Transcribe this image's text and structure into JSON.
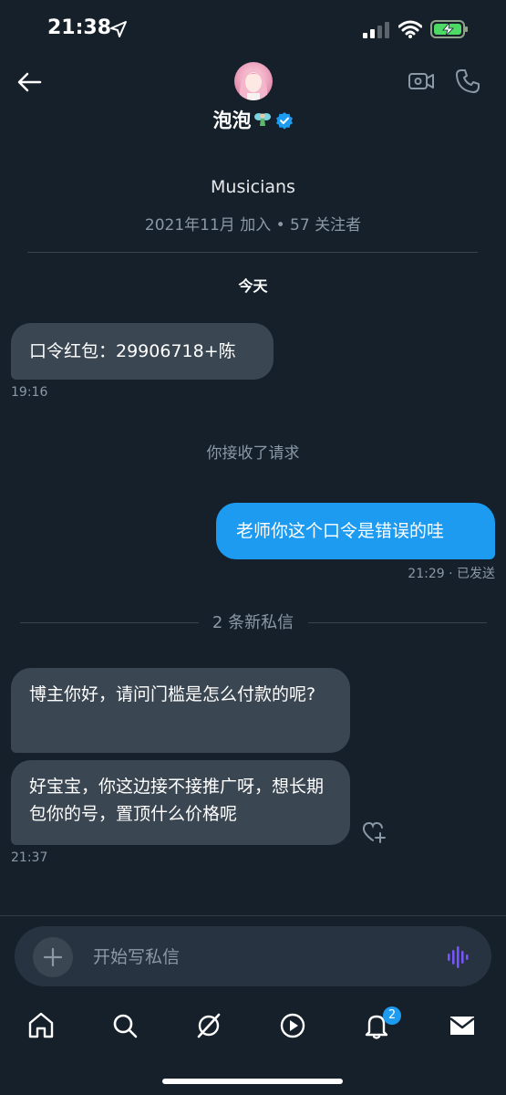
{
  "status_bar": {
    "time": "21:38"
  },
  "header": {
    "name": "泡泡"
  },
  "profile": {
    "bio": "Musicians",
    "meta": "2021年11月 加入 • 57 关注者"
  },
  "conversation": {
    "day_label": "今天",
    "messages": [
      {
        "text": "口令红包：29906718+陈",
        "time": "19:16"
      },
      {
        "text": "老师你这个口令是错误的哇",
        "time": "21:29 · 已发送"
      },
      {
        "text": "博主你好，请问门槛是怎么付款的呢?"
      },
      {
        "text": "好宝宝，你这边接不接推广呀，想长期包你的号，置顶什么价格呢",
        "time": "21:37"
      }
    ],
    "system_notice": "你接收了请求",
    "new_messages_label": "2 条新私信"
  },
  "composer": {
    "placeholder": "开始写私信"
  },
  "bottom_nav": {
    "notifications_badge": "2"
  },
  "colors": {
    "background": "#15202b",
    "bubble": "#3a4652",
    "accent": "#1d9bf0"
  }
}
